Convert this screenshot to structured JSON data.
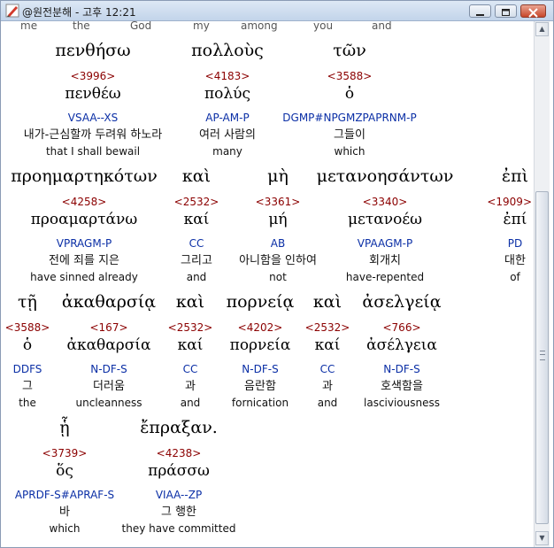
{
  "window": {
    "title": "@원전분해 - 고후 12:21",
    "icons": {
      "app": "app-icon",
      "minimize": "minimize-icon",
      "maximize": "maximize-icon",
      "close": "close-icon"
    },
    "colors": {
      "strong": "#8b0000",
      "parse": "#0b2fa6"
    }
  },
  "cutoff_row": [
    "me",
    "the",
    "God",
    "my",
    "among",
    "you",
    "and"
  ],
  "rows": [
    {
      "words": [
        {
          "greek": "πενθήσω",
          "strong": "<3996>",
          "lemma": "πενθέω",
          "parse": "VSAA--XS",
          "kor": "내가-근심할까 두려워 하노라",
          "eng": "that I shall bewail"
        },
        {
          "greek": "πολλοὺς",
          "strong": "<4183>",
          "lemma": "πολύς",
          "parse": "AP-AM-P",
          "kor": "여러 사람의",
          "eng": "many"
        },
        {
          "greek": "τῶν",
          "strong": "<3588>",
          "lemma": "ὁ",
          "parse": "DGMP#NPGMZPAPRNM-P",
          "kor": "그들이",
          "eng": "which"
        }
      ]
    },
    {
      "words": [
        {
          "greek": "προημαρτηκότων",
          "strong": "<4258>",
          "lemma": "προαμαρτάνω",
          "parse": "VPRAGM-P",
          "kor": "전에 죄를 지은",
          "eng": "have sinned already"
        },
        {
          "greek": "καὶ",
          "strong": "<2532>",
          "lemma": "καί",
          "parse": "CC",
          "kor": "그리고",
          "eng": "and"
        },
        {
          "greek": "μὴ",
          "strong": "<3361>",
          "lemma": "μή",
          "parse": "AB",
          "kor": "아니함을 인하여",
          "eng": "not"
        },
        {
          "greek": "μετανοησάντων",
          "strong": "<3340>",
          "lemma": "μετανοέω",
          "parse": "VPAAGM-P",
          "kor": "회개치",
          "eng": "have-repented"
        },
        {
          "greek": "ἐπὶ",
          "strong": "<1909>",
          "lemma": "ἐπί",
          "parse": "PD",
          "kor": "대한",
          "eng": "of"
        }
      ]
    },
    {
      "words": [
        {
          "greek": "τῇ",
          "strong": "<3588>",
          "lemma": "ὁ",
          "parse": "DDFS",
          "kor": "그",
          "eng": "the"
        },
        {
          "greek": "ἀκαθαρσίᾳ",
          "strong": "<167>",
          "lemma": "ἀκαθαρσία",
          "parse": "N-DF-S",
          "kor": "더러움",
          "eng": "uncleanness"
        },
        {
          "greek": "καὶ",
          "strong": "<2532>",
          "lemma": "καί",
          "parse": "CC",
          "kor": "과",
          "eng": "and"
        },
        {
          "greek": "πορνείᾳ",
          "strong": "<4202>",
          "lemma": "πορνεία",
          "parse": "N-DF-S",
          "kor": "음란함",
          "eng": "fornication"
        },
        {
          "greek": "καὶ",
          "strong": "<2532>",
          "lemma": "καί",
          "parse": "CC",
          "kor": "과",
          "eng": "and"
        },
        {
          "greek": "ἀσελγείᾳ",
          "strong": "<766>",
          "lemma": "ἀσέλγεια",
          "parse": "N-DF-S",
          "kor": "호색함을",
          "eng": "lasciviousness"
        }
      ]
    },
    {
      "words": [
        {
          "greek": "ᾗ",
          "strong": "<3739>",
          "lemma": "ὅς",
          "parse": "APRDF-S#APRAF-S",
          "kor": "바",
          "eng": "which"
        },
        {
          "greek": "ἔπραξαν.",
          "strong": "<4238>",
          "lemma": "πράσσω",
          "parse": "VIAA--ZP",
          "kor": "그 행한",
          "eng": "they have committed"
        }
      ]
    }
  ]
}
